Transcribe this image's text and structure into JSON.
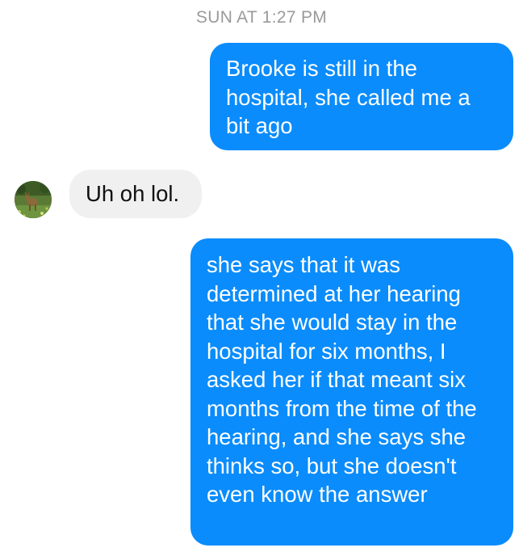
{
  "thread": {
    "timestamp": "SUN AT 1:27 PM",
    "messages": [
      {
        "direction": "outgoing",
        "text": "Brooke is still in the hospital, she called me a bit ago"
      },
      {
        "direction": "incoming",
        "text": "Uh oh lol.",
        "avatar_icon": "deer-in-grass-avatar"
      },
      {
        "direction": "outgoing",
        "text": "she says that it was determined at her hearing that she would stay in the hospital for six months, I asked her if that meant six months from the time of the hearing, and she says she thinks so, but she doesn't even know the answer"
      }
    ]
  },
  "colors": {
    "outgoing_bubble": "#0a8cfc",
    "incoming_bubble": "#f0f0f0",
    "timestamp_text": "#9a9a9a"
  }
}
